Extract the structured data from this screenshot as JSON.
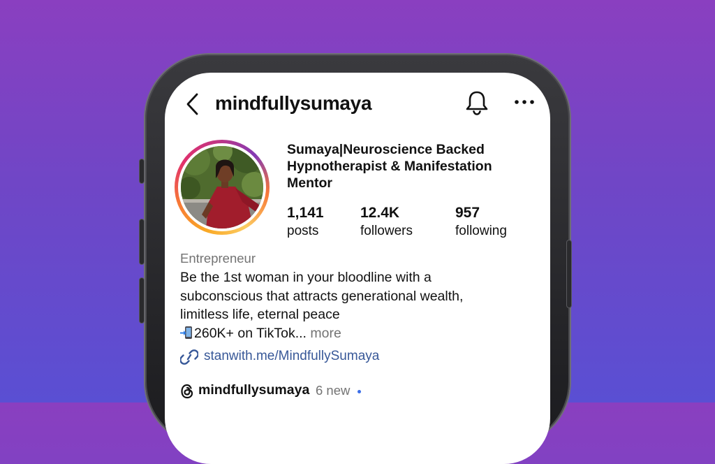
{
  "header": {
    "username": "mindfullysumaya",
    "icons": [
      "chevron-left-icon",
      "bell-icon",
      "more-horizontal-icon"
    ]
  },
  "profile": {
    "display_name": "Sumaya|Neuroscience Backed Hypnotherapist & Manifestation Mentor",
    "stats": [
      {
        "value": "1,141",
        "label": "posts"
      },
      {
        "value": "12.4K",
        "label": "followers"
      },
      {
        "value": "957",
        "label": "following"
      }
    ],
    "category": "Entrepreneur",
    "bio": {
      "line1": "Be the 1st woman in your bloodline with a",
      "line2": "subconscious that attracts generational wealth,",
      "line3": "limitless life, eternal peace",
      "line4": "260K+ on TikTok...",
      "more": "more",
      "line4_icon": "mobile-phone-arrow-emoji"
    },
    "link": "stanwith.me/MindfullySumaya",
    "threads": {
      "username": "mindfullysumaya",
      "new_label": "6 new"
    }
  },
  "colors": {
    "background_top": "#8a3fc0",
    "background_bottom": "#5a4fd3",
    "link": "#385898",
    "muted_text": "#737373",
    "new_dot": "#3b6ee8"
  }
}
